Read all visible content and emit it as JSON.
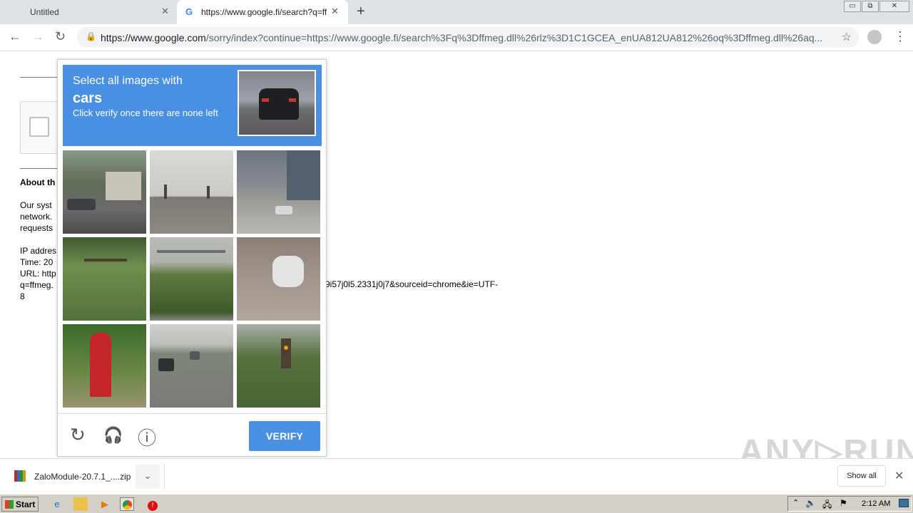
{
  "browser": {
    "tabs": [
      {
        "title": "Untitled",
        "close": "✕"
      },
      {
        "title": "https://www.google.fi/search?q=ffmeg",
        "close": "✕"
      }
    ],
    "new_tab": "+",
    "window_controls": {
      "minimize": "▭",
      "restore": "⧉",
      "close": "✕"
    },
    "nav": {
      "back": "←",
      "forward": "→",
      "reload": "↻"
    },
    "url_host": "https://www.google.com",
    "url_rest": "/sorry/index?continue=https://www.google.fi/search%3Fq%3Dffmeg.dll%26rlz%3D1C1GCEA_enUA812UA812%26oq%3Dffmeg.dll%26aq...",
    "bookmark": "☆",
    "menu": "⋮"
  },
  "page": {
    "about_heading": "About th",
    "paragraph": [
      "Our syst",
      "network.",
      "requests"
    ],
    "meta": [
      "IP addres",
      "Time: 20",
      "URL: http",
      "q=ffmeg.",
      "8"
    ],
    "url_tail": "9i57j0l5.2331j0j7&sourceid=chrome&ie=UTF-"
  },
  "captcha": {
    "instruction_line1": "Select all images with",
    "target_word": "cars",
    "instruction_line3": "Click verify once there are none left",
    "tiles": [
      {
        "scene": "street-with-parked-cars"
      },
      {
        "scene": "wall-and-palms"
      },
      {
        "scene": "city-intersection"
      },
      {
        "scene": "grass-and-fence"
      },
      {
        "scene": "overpass-and-trees"
      },
      {
        "scene": "parked-motorcycle"
      },
      {
        "scene": "fire-hydrant"
      },
      {
        "scene": "highway-traffic"
      },
      {
        "scene": "traffic-light"
      }
    ],
    "reload_icon": "↻",
    "audio_icon": "🎧",
    "info_icon": "ⓘ",
    "verify_label": "VERIFY"
  },
  "downloads": {
    "filename": "ZaloModule-20.7.1_....zip",
    "chevron": "⌄",
    "show_all": "Show all",
    "close": "✕"
  },
  "watermark": "ANY▷RUN",
  "taskbar": {
    "start": "Start",
    "clock": "2:12 AM"
  },
  "colors": {
    "captcha_blue": "#4a90e2",
    "tab_strip": "#dee1e6",
    "taskbar": "#d4d0c8"
  }
}
